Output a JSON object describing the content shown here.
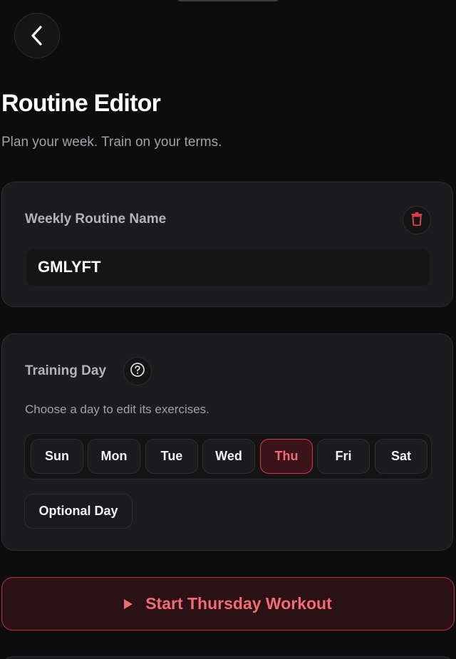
{
  "header": {
    "title": "Routine Editor",
    "subtitle": "Plan your week. Train on your terms."
  },
  "routine_name": {
    "label": "Weekly Routine Name",
    "value": "GMLYFT"
  },
  "training_day": {
    "label": "Training Day",
    "hint": "Choose a day to edit its exercises.",
    "days": [
      "Sun",
      "Mon",
      "Tue",
      "Wed",
      "Thu",
      "Fri",
      "Sat"
    ],
    "selected_day": "Thu",
    "optional_label": "Optional Day"
  },
  "start_button": {
    "label": "Start Thursday Workout"
  },
  "icons": {
    "back": "chevron-left-icon",
    "trash": "trash-icon",
    "help": "help-circle-icon",
    "play": "play-icon"
  },
  "colors": {
    "background": "#0d0d0e",
    "card": "#1c1c1e",
    "accent": "#f06b74",
    "accent_border": "#d63a47",
    "accent_bg": "#3a1418",
    "trash": "#e03e4b"
  }
}
